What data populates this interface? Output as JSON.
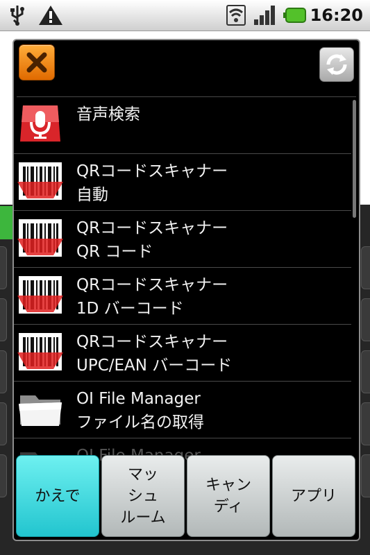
{
  "status_bar": {
    "time": "16:20",
    "icons": [
      "usb-icon",
      "warning-icon",
      "wifi-icon",
      "signal-icon",
      "battery-icon"
    ]
  },
  "dialog": {
    "header": {
      "close_icon": "close-icon",
      "refresh_icon": "refresh-icon"
    },
    "items": [
      {
        "icon": "microphone-icon",
        "line1": "音声検索",
        "line2": ""
      },
      {
        "icon": "barcode-icon",
        "line1": "QRコードスキャナー",
        "line2": "自動"
      },
      {
        "icon": "barcode-icon",
        "line1": "QRコードスキャナー",
        "line2": "QR コード"
      },
      {
        "icon": "barcode-icon",
        "line1": "QRコードスキャナー",
        "line2": "1D バーコード"
      },
      {
        "icon": "barcode-icon",
        "line1": "QRコードスキャナー",
        "line2": "UPC/EAN バーコード"
      },
      {
        "icon": "folder-icon",
        "line1": "OI File Manager",
        "line2": "ファイル名の取得"
      },
      {
        "icon": "folder-icon",
        "line1": "OI File Manager",
        "line2": ""
      }
    ],
    "tabs": [
      {
        "label": "かえで",
        "selected": true
      },
      {
        "label": "マッシュルーム",
        "lines": [
          "マッ",
          "シュ",
          "ルーム"
        ],
        "selected": false
      },
      {
        "label": "キャンディ",
        "lines": [
          "キャン",
          "ディ"
        ],
        "selected": false
      },
      {
        "label": "アプリ",
        "selected": false
      }
    ]
  },
  "colors": {
    "accent": "#22c5cf",
    "close_orange": "#e06a00",
    "mic_red": "#d9252a",
    "scan_red": "#e02020"
  }
}
